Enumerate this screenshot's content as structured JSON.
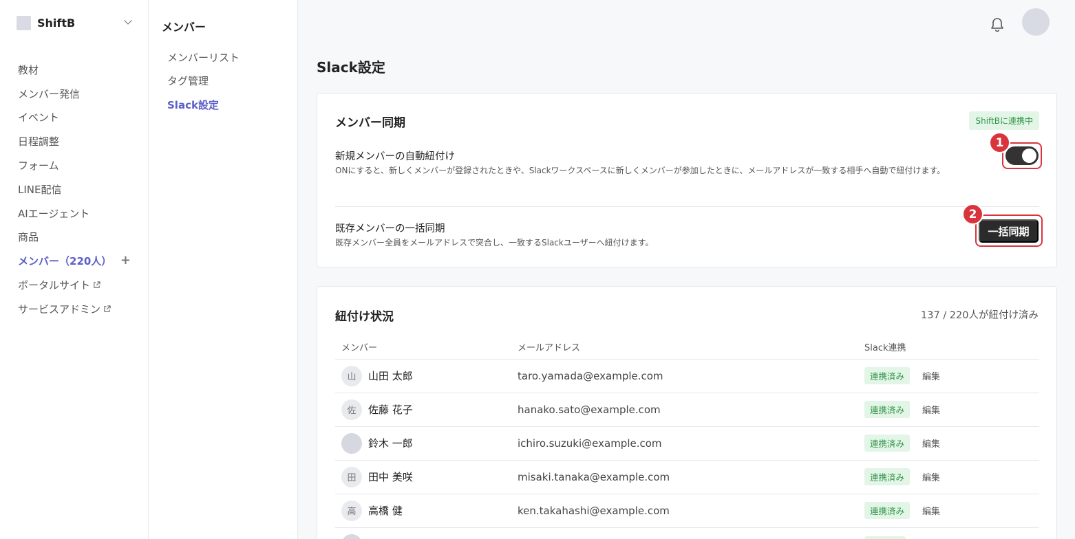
{
  "workspace": {
    "name": "ShiftB"
  },
  "sidebar": {
    "items": [
      {
        "label": "教材"
      },
      {
        "label": "メンバー発信"
      },
      {
        "label": "イベント"
      },
      {
        "label": "日程調整"
      },
      {
        "label": "フォーム"
      },
      {
        "label": "LINE配信"
      },
      {
        "label": "AIエージェント"
      },
      {
        "label": "商品"
      },
      {
        "label": "メンバー（220人）"
      },
      {
        "label": "ポータルサイト"
      },
      {
        "label": "サービスアドミン"
      }
    ]
  },
  "subnav": {
    "title": "メンバー",
    "items": [
      {
        "label": "メンバーリスト"
      },
      {
        "label": "タグ管理"
      },
      {
        "label": "Slack設定"
      }
    ]
  },
  "page": {
    "title": "Slack設定"
  },
  "sync_card": {
    "title": "メンバー同期",
    "status_badge": "ShiftBに連携中",
    "auto_link": {
      "title": "新規メンバーの自動紐付け",
      "description": "ONにすると、新しくメンバーが登録されたときや、Slackワークスペースに新しくメンバーが参加したときに、メールアドレスが一致する相手へ自動で紐付けます。",
      "enabled": true,
      "marker": "1"
    },
    "bulk_sync": {
      "title": "既存メンバーの一括同期",
      "description": "既存メンバー全員をメールアドレスで突合し、一致するSlackユーザーへ紐付けます。",
      "button_label": "一括同期",
      "marker": "2"
    }
  },
  "link_card": {
    "title": "紐付け状況",
    "count": "137 / 220人が紐付け済み",
    "columns": {
      "member": "メンバー",
      "email": "メールアドレス",
      "slack": "Slack連携"
    },
    "rows": [
      {
        "initial": "山",
        "name": "山田 太郎",
        "email": "taro.yamada@example.com",
        "status": "連携済み",
        "action": "編集"
      },
      {
        "initial": "佐",
        "name": "佐藤 花子",
        "email": "hanako.sato@example.com",
        "status": "連携済み",
        "action": "編集"
      },
      {
        "initial": "",
        "name": "鈴木 一郎",
        "email": "ichiro.suzuki@example.com",
        "status": "連携済み",
        "action": "編集"
      },
      {
        "initial": "田",
        "name": "田中 美咲",
        "email": "misaki.tanaka@example.com",
        "status": "連携済み",
        "action": "編集"
      },
      {
        "initial": "高",
        "name": "高橋 健",
        "email": "ken.takahashi@example.com",
        "status": "連携済み",
        "action": "編集"
      },
      {
        "initial": "",
        "name": "",
        "email": "",
        "status": "",
        "action": ""
      }
    ]
  },
  "colors": {
    "accent": "#5b5fc7",
    "highlight": "#d9343c",
    "success": "#2e9347"
  }
}
